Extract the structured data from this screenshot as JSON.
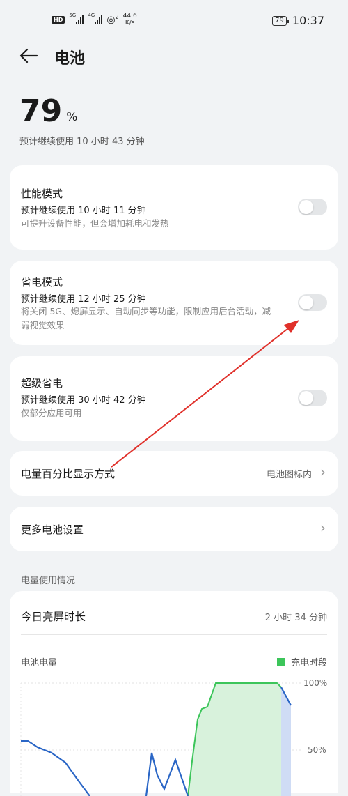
{
  "status_bar": {
    "hd": "HD",
    "sim1_gen": "5G",
    "sim2_gen": "4G",
    "wifi_gen": "2",
    "speed_value": "44.6",
    "speed_unit": "K/s",
    "battery": "79",
    "time": "10:37"
  },
  "header": {
    "back_icon": "back-arrow-icon",
    "title": "电池"
  },
  "battery_level": {
    "value": "79",
    "unit": "%",
    "estimate": "预计继续使用 10 小时 43 分钟"
  },
  "modes": [
    {
      "title": "性能模式",
      "estimate": "预计继续使用 10 小时 11 分钟",
      "desc": "可提升设备性能，但会增加耗电和发热",
      "enabled": false
    },
    {
      "title": "省电模式",
      "estimate": "预计继续使用 12 小时 25 分钟",
      "desc": "将关闭 5G、熄屏显示、自动同步等功能，限制应用后台活动，减弱视觉效果",
      "enabled": false
    },
    {
      "title": "超级省电",
      "estimate": "预计继续使用 30 小时 42 分钟",
      "desc": "仅部分应用可用",
      "enabled": false
    }
  ],
  "percent_display": {
    "label": "电量百分比显示方式",
    "value": "电池图标内"
  },
  "more_settings": {
    "label": "更多电池设置"
  },
  "usage": {
    "section": "电量使用情况",
    "screen_time_label": "今日亮屏时长",
    "screen_time_value": "2 小时 34 分钟",
    "chart_label": "电池电量",
    "legend_label": "充电时段",
    "y_top": "100%",
    "y_mid": "50%"
  },
  "colors": {
    "charging": "#3cc55a",
    "line": "#2a66c6",
    "annotation": "#e0302a"
  }
}
